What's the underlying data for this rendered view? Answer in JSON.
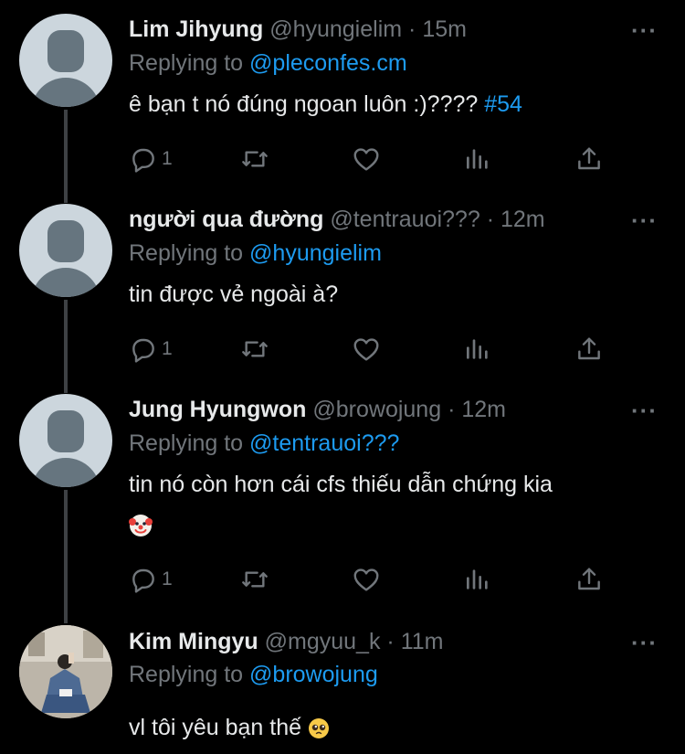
{
  "tweets": [
    {
      "name": "Lim Jihyung",
      "handle": "@hyungielim",
      "time": "15m",
      "reply_prefix": "Replying to",
      "reply_to": "@pleconfes.cm",
      "text": "ê bạn t nó đúng ngoan luôn :)????",
      "hashtag": "#54",
      "reply_count": "1"
    },
    {
      "name": "người qua đường",
      "handle": "@tentrauoi???",
      "time": "12m",
      "reply_prefix": "Replying to",
      "reply_to": "@hyungielim",
      "text": "tin được vẻ ngoài à?",
      "reply_count": "1"
    },
    {
      "name": "Jung Hyungwon",
      "handle": "@browojung",
      "time": "12m",
      "reply_prefix": "Replying to",
      "reply_to": "@tentrauoi???",
      "text": "tin nó còn hơn cái cfs thiếu dẫn chứng kia",
      "emoji": "clown-face",
      "reply_count": "1"
    },
    {
      "name": "Kim Mingyu",
      "handle": "@mgyuu_k",
      "time": "11m",
      "reply_prefix": "Replying to",
      "reply_to": "@browojung",
      "text": "vl tôi yêu bạn thế",
      "emoji": "pleading-face"
    }
  ],
  "icons": {
    "reply": "reply-icon",
    "retweet": "retweet-icon",
    "like": "heart-icon",
    "analytics": "analytics-icon",
    "share": "share-icon",
    "more": "more-icon"
  },
  "colors": {
    "background": "#000000",
    "text": "#e7e9ea",
    "muted": "#71767b",
    "link": "#1d9bf0",
    "thread_line": "#3e4144"
  },
  "dot_separator": "·",
  "more_glyph": "···"
}
